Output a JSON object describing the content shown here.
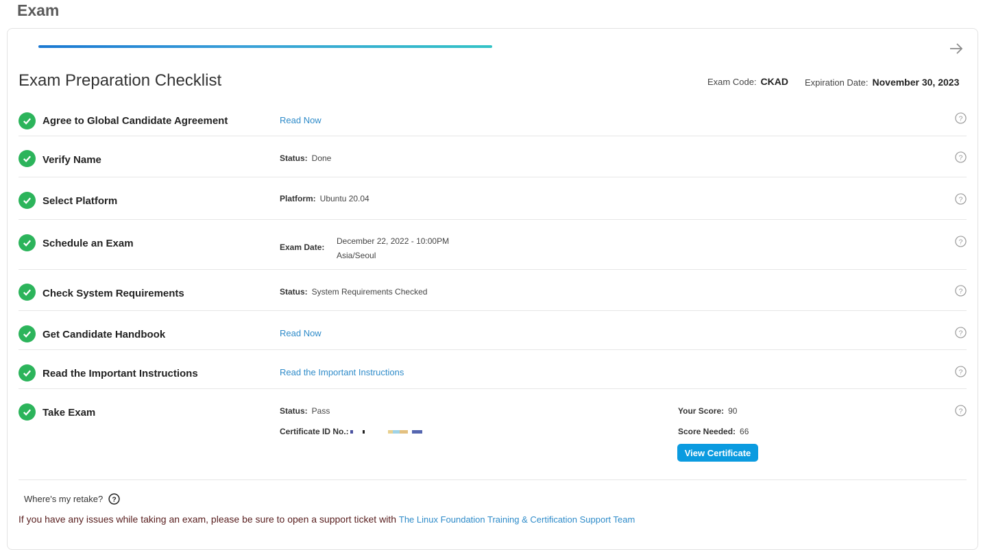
{
  "page": {
    "title": "Exam"
  },
  "checklist": {
    "title": "Exam Preparation Checklist",
    "exam_code_label": "Exam Code:",
    "exam_code": "CKAD",
    "expiration_label": "Expiration Date:",
    "expiration_date": "November 30, 2023",
    "progress_fraction": 1.0
  },
  "rows": [
    {
      "task": "Agree to Global Candidate Agreement",
      "link": "Read Now"
    },
    {
      "task": "Verify Name",
      "label": "Status:",
      "value": "Done"
    },
    {
      "task": "Select Platform",
      "label": "Platform:",
      "value": "Ubuntu 20.04"
    },
    {
      "task": "Schedule an Exam",
      "label": "Exam Date:",
      "value_line1": "December 22, 2022 - 10:00PM",
      "value_line2": "Asia/Seoul"
    },
    {
      "task": "Check System Requirements",
      "label": "Status:",
      "value": "System Requirements Checked"
    },
    {
      "task": "Get Candidate Handbook",
      "link": "Read Now"
    },
    {
      "task": "Read the Important Instructions",
      "link": "Read the Important Instructions"
    },
    {
      "task": "Take Exam",
      "status_label": "Status:",
      "status_value": "Pass",
      "cert_label": "Certificate ID No.:",
      "score_label": "Your Score:",
      "score_value": "90",
      "needed_label": "Score Needed:",
      "needed_value": "66",
      "button": "View Certificate"
    }
  ],
  "footer": {
    "retake": "Where's my retake?",
    "support_text": "If you have any issues while taking an exam, please be sure to open a support ticket with",
    "support_link": "The Linux Foundation Training & Certification Support Team"
  },
  "colors": {
    "check_green": "#2cb45b",
    "link_blue": "#2e8bc9",
    "button_blue": "#0b9be0"
  },
  "icons": {
    "check": "check-circle-icon",
    "help": "help-circle-icon",
    "next": "arrow-right-icon"
  }
}
